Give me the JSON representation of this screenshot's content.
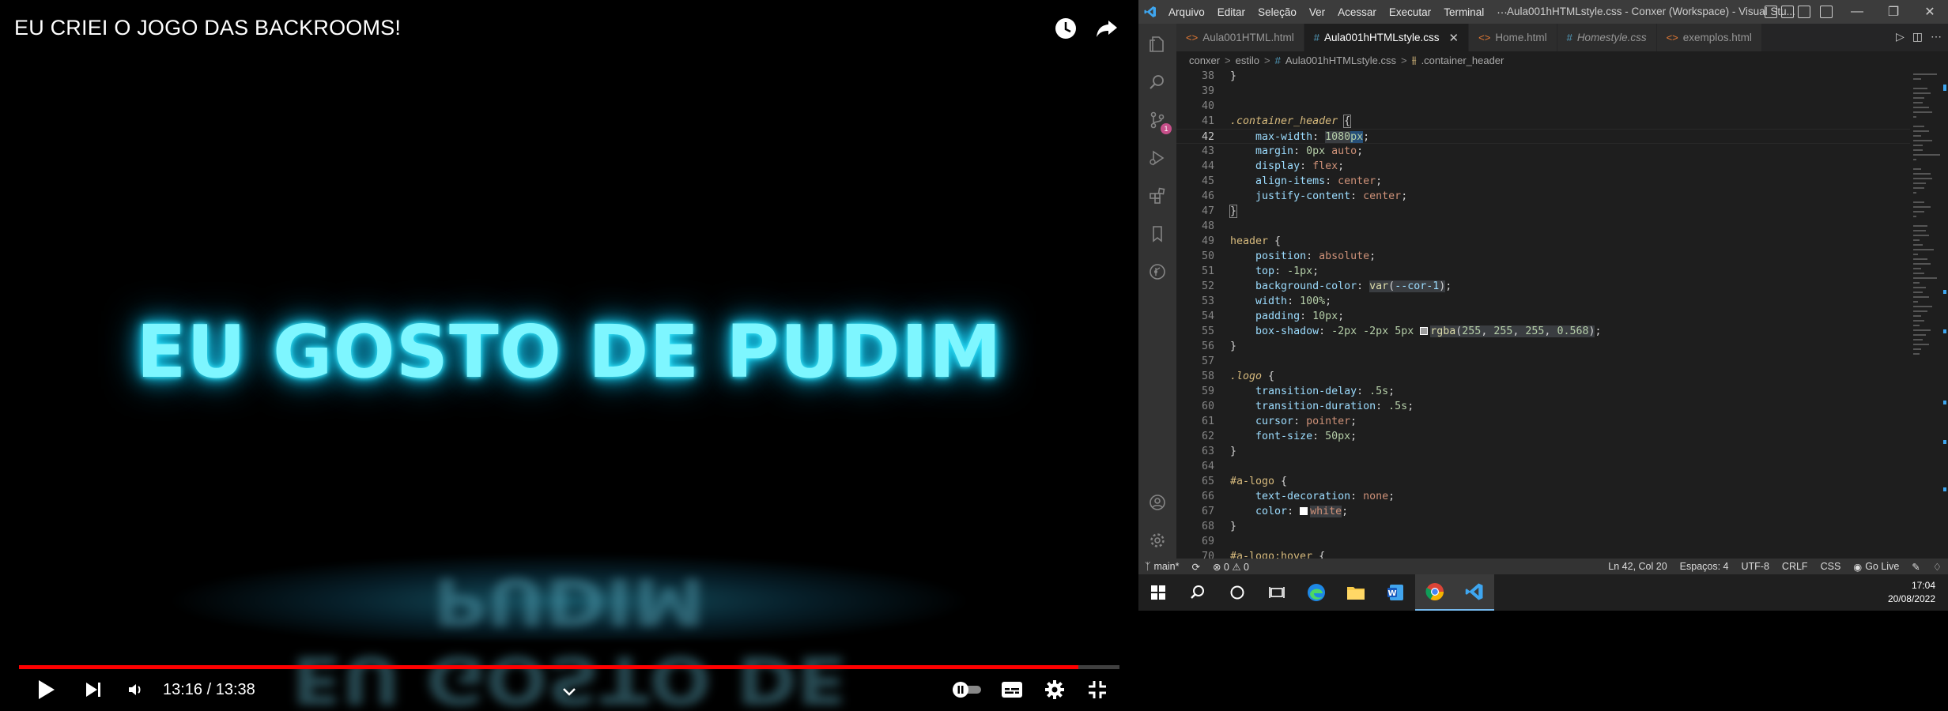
{
  "player": {
    "title": "EU CRIEI O JOGO DAS BACKROOMS!",
    "video_text": "EU GOSTO DE PUDIM",
    "time": "13:16 / 13:38",
    "progress": 0.963,
    "icons": [
      "clock-icon",
      "share-icon",
      "play-icon",
      "next-icon",
      "volume-icon",
      "chevron-down-icon",
      "autoplay-toggle",
      "captions-icon",
      "gear-icon",
      "exit-fullscreen-icon"
    ]
  },
  "vscode": {
    "menu": [
      "Arquivo",
      "Editar",
      "Seleção",
      "Ver",
      "Acessar",
      "Executar",
      "Terminal",
      "···"
    ],
    "window_title": "Aula001hHTMLstyle.css - Conxer (Workspace) - Visual Stu...",
    "tabs": [
      {
        "label": "Aula001HTML.html",
        "kind": "html",
        "active": false,
        "italic": false
      },
      {
        "label": "Aula001hHTMLstyle.css",
        "kind": "css",
        "active": true,
        "italic": false
      },
      {
        "label": "Home.html",
        "kind": "html",
        "active": false,
        "italic": false
      },
      {
        "label": "Homestyle.css",
        "kind": "css",
        "active": false,
        "italic": true
      },
      {
        "label": "exemplos.html",
        "kind": "html",
        "active": false,
        "italic": false
      }
    ],
    "breadcrumb": [
      "conxer",
      "estilo",
      "Aula001hHTMLstyle.css",
      ".container_header"
    ],
    "source_control_badge": "1",
    "line_numbers": [
      "38",
      "39",
      "40",
      "41",
      "42",
      "43",
      "44",
      "45",
      "46",
      "47",
      "48",
      "49",
      "50",
      "51",
      "52",
      "53",
      "54",
      "55",
      "56",
      "57",
      "58",
      "59",
      "60",
      "61",
      "62",
      "63",
      "64",
      "65",
      "66",
      "67",
      "68",
      "69",
      "70"
    ],
    "current_line": "42",
    "status": {
      "branch": "main*",
      "problems": "⊗ 0 ⚠ 0",
      "position": "Ln 42, Col 20",
      "spaces": "Espaços: 4",
      "encoding": "UTF-8",
      "eol": "CRLF",
      "language": "CSS",
      "go_live": "Go Live"
    }
  },
  "taskbar": {
    "time": "17:04",
    "date": "20/08/2022",
    "apps": [
      "windows-icon",
      "search-icon",
      "cortana-icon",
      "task-view-icon",
      "edge-icon",
      "file-explorer-icon",
      "word-icon",
      "chrome-icon",
      "vscode-icon"
    ]
  },
  "colors": {
    "neon": "#7ef6ff",
    "progress": "#ff0000",
    "vscode_bg": "#1e1e1e",
    "status_bar": "#333333"
  }
}
